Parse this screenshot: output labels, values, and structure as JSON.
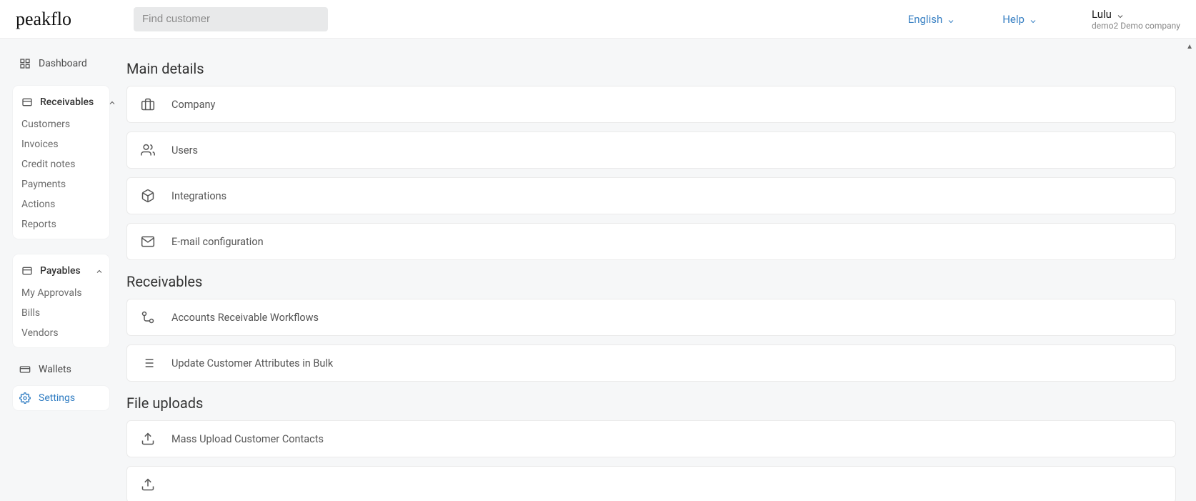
{
  "header": {
    "logo_text": "peakflo",
    "search_placeholder": "Find customer",
    "lang": "English",
    "help": "Help",
    "user_name": "Lulu",
    "user_company": "demo2 Demo company"
  },
  "sidebar": {
    "dashboard": "Dashboard",
    "receivables": {
      "label": "Receivables",
      "items": [
        "Customers",
        "Invoices",
        "Credit notes",
        "Payments",
        "Actions",
        "Reports"
      ]
    },
    "payables": {
      "label": "Payables",
      "items": [
        "My Approvals",
        "Bills",
        "Vendors"
      ]
    },
    "wallets": "Wallets",
    "settings": "Settings"
  },
  "main": {
    "sections": {
      "main_details": {
        "title": "Main details",
        "items": [
          "Company",
          "Users",
          "Integrations",
          "E-mail configuration"
        ]
      },
      "receivables": {
        "title": "Receivables",
        "items": [
          "Accounts Receivable Workflows",
          "Update Customer Attributes in Bulk"
        ]
      },
      "file_uploads": {
        "title": "File uploads",
        "items": [
          "Mass Upload Customer Contacts"
        ]
      }
    }
  }
}
